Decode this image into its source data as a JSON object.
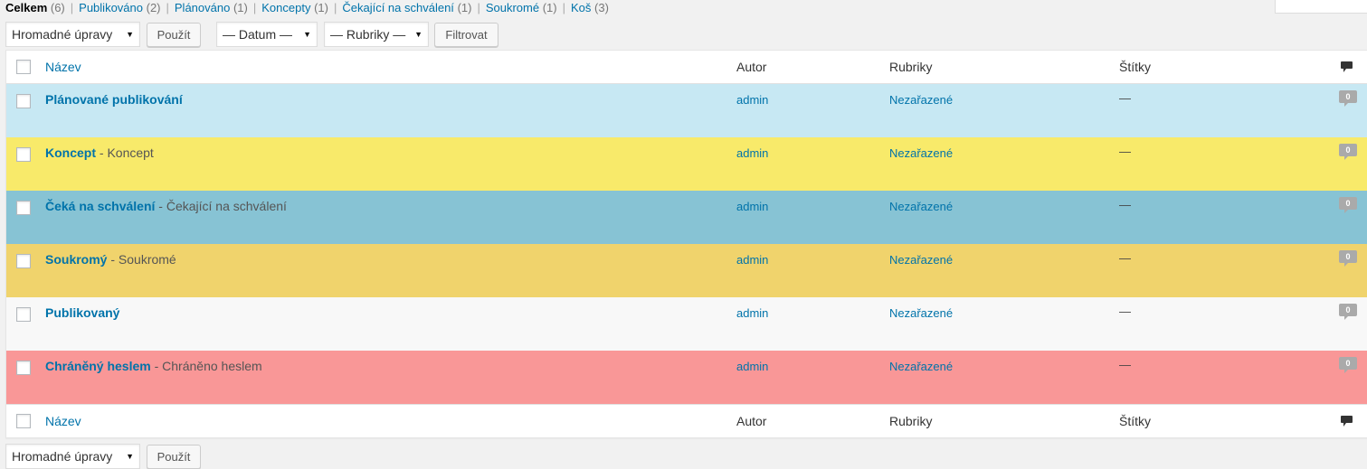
{
  "status_links": [
    {
      "label": "Celkem",
      "count": "(6)",
      "current": true
    },
    {
      "label": "Publikováno",
      "count": "(2)"
    },
    {
      "label": "Plánováno",
      "count": "(1)"
    },
    {
      "label": "Koncepty",
      "count": "(1)"
    },
    {
      "label": "Čekající na schválení",
      "count": "(1)"
    },
    {
      "label": "Soukromé",
      "count": "(1)"
    },
    {
      "label": "Koš",
      "count": "(3)"
    }
  ],
  "separator": "|",
  "tablenav_top": {
    "bulk_select": "Hromadné úpravy",
    "apply_button": "Použít",
    "date_select": "— Datum —",
    "category_select": "— Rubriky —",
    "filter_button": "Filtrovat",
    "caret": "▼"
  },
  "tablenav_bottom": {
    "bulk_select": "Hromadné úpravy",
    "apply_button": "Použít",
    "caret": "▼"
  },
  "columns": {
    "title": "Název",
    "author": "Autor",
    "categories": "Rubriky",
    "tags": "Štítky",
    "comments_icon": "comment-icon"
  },
  "rows": [
    {
      "title": "Plánované publikování",
      "state": "",
      "author": "admin",
      "category": "Nezařazené",
      "tags": "—",
      "comments": "0",
      "bg": "#c7e8f3"
    },
    {
      "title": "Koncept",
      "state": " - Koncept",
      "author": "admin",
      "category": "Nezařazené",
      "tags": "—",
      "comments": "0",
      "bg": "#f8ea6a"
    },
    {
      "title": "Čeká na schválení",
      "state": " - Čekající na schválení",
      "author": "admin",
      "category": "Nezařazené",
      "tags": "—",
      "comments": "0",
      "bg": "#87c3d4"
    },
    {
      "title": "Soukromý",
      "state": " - Soukromé",
      "author": "admin",
      "category": "Nezařazené",
      "tags": "—",
      "comments": "0",
      "bg": "#f0d36c"
    },
    {
      "title": "Publikovaný",
      "state": "",
      "author": "admin",
      "category": "Nezařazené",
      "tags": "—",
      "comments": "0",
      "bg": "#f8f8f8"
    },
    {
      "title": "Chráněný heslem",
      "state": " - Chráněno heslem",
      "author": "admin",
      "category": "Nezařazené",
      "tags": "—",
      "comments": "0",
      "bg": "#f99797"
    }
  ],
  "colors": {
    "link": "#0073aa",
    "bubble": "#aaaaaa",
    "head_icon": "#333333"
  }
}
